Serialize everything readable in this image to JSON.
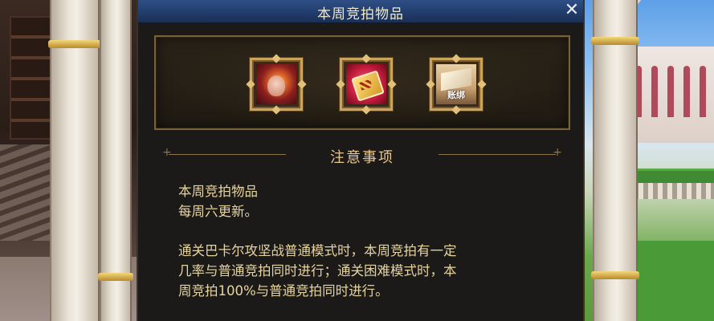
{
  "window": {
    "title": "本周竞拍物品",
    "close_glyph": "✕"
  },
  "items": [
    {
      "icon": "character-portrait-icon",
      "tag": ""
    },
    {
      "icon": "gift-card-icon",
      "tag": ""
    },
    {
      "icon": "package-box-icon",
      "tag": "账绑"
    }
  ],
  "notice": {
    "heading": "注意事项",
    "paragraph1_line1": "本周竞拍物品",
    "paragraph1_line2": "每周六更新。",
    "paragraph2_line1": "通关巴卡尔攻坚战普通模式时，本周竞拍有一定",
    "paragraph2_line2": "几率与普通竞拍同时进行；通关困难模式时，本",
    "paragraph2_line3": "周竞拍100%与普通竞拍同时进行。"
  },
  "colors": {
    "title_bar": "#223d6c",
    "text_gold": "#e6d4a0",
    "frame_gold": "#c9a45a"
  }
}
